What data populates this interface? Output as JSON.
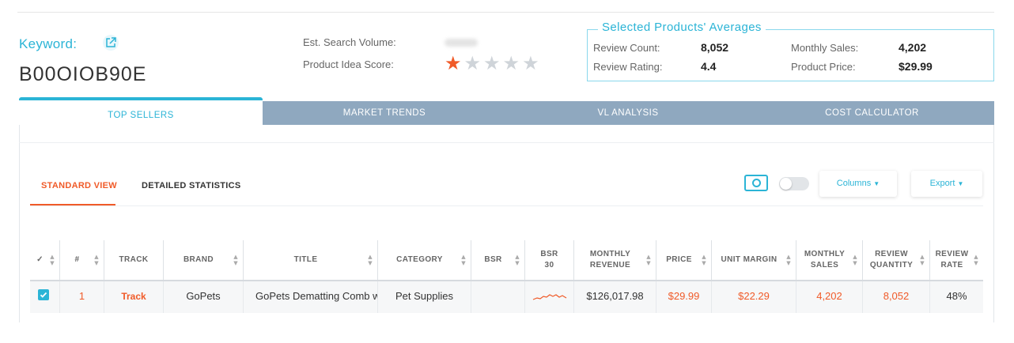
{
  "header": {
    "keyword_label": "Keyword:",
    "keyword_value": "B00OIOB90E",
    "est_search_volume_label": "Est. Search Volume:",
    "product_idea_score_label": "Product Idea Score:",
    "product_idea_score": 1,
    "product_idea_score_max": 5
  },
  "averages": {
    "title": "Selected Products' Averages",
    "review_count_label": "Review Count:",
    "review_count": "8,052",
    "review_rating_label": "Review Rating:",
    "review_rating": "4.4",
    "monthly_sales_label": "Monthly Sales:",
    "monthly_sales": "4,202",
    "product_price_label": "Product Price:",
    "product_price": "$29.99"
  },
  "tabs": [
    "TOP SELLERS",
    "MARKET TRENDS",
    "VL ANALYSIS",
    "COST CALCULATOR"
  ],
  "view_tabs": [
    "STANDARD VIEW",
    "DETAILED STATISTICS"
  ],
  "toolbar": {
    "columns_label": "Columns",
    "export_label": "Export"
  },
  "table": {
    "headers": [
      "✓",
      "#",
      "TRACK",
      "BRAND",
      "TITLE",
      "CATEGORY",
      "BSR",
      "BSR\n30",
      "MONTHLY\nREVENUE",
      "PRICE",
      "UNIT MARGIN",
      "MONTHLY\nSALES",
      "REVIEW\nQUANTITY",
      "REVIEW\nRATE"
    ],
    "row": {
      "num": "1",
      "track": "Track",
      "brand": "GoPets",
      "title": "GoPets Dematting Comb with",
      "category": "Pet Supplies",
      "bsr": "",
      "monthly_revenue": "$126,017.98",
      "price": "$29.99",
      "unit_margin": "$22.29",
      "monthly_sales": "4,202",
      "review_quantity": "8,052",
      "review_rate": "48%"
    }
  },
  "colors": {
    "accent": "#2bb4d6",
    "orange": "#f05a28",
    "tab_inactive": "#8fa8bf"
  }
}
